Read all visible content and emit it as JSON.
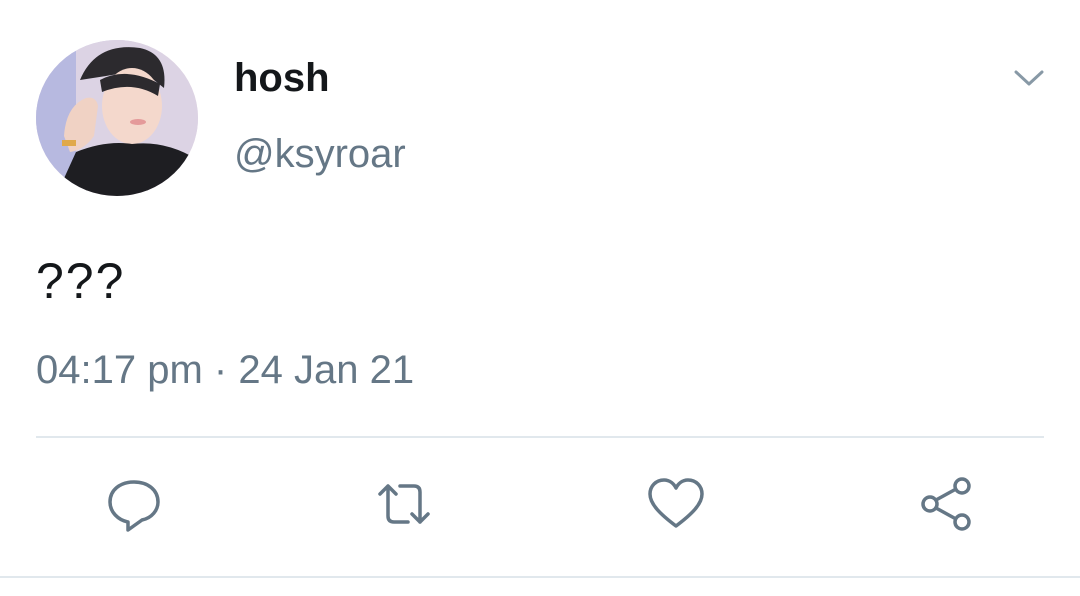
{
  "tweet": {
    "display_name": "hosh",
    "handle": "@ksyroar",
    "text": "???",
    "time": "04:17 pm",
    "separator": "·",
    "date": "24 Jan 21"
  },
  "icons": {
    "menu": "chevron-down-icon",
    "reply": "reply-icon",
    "retweet": "retweet-icon",
    "like": "heart-icon",
    "share": "share-icon"
  },
  "colors": {
    "text_primary": "#14171a",
    "text_secondary": "#657786",
    "icon": "#657786",
    "divider": "#e1e8ed"
  }
}
